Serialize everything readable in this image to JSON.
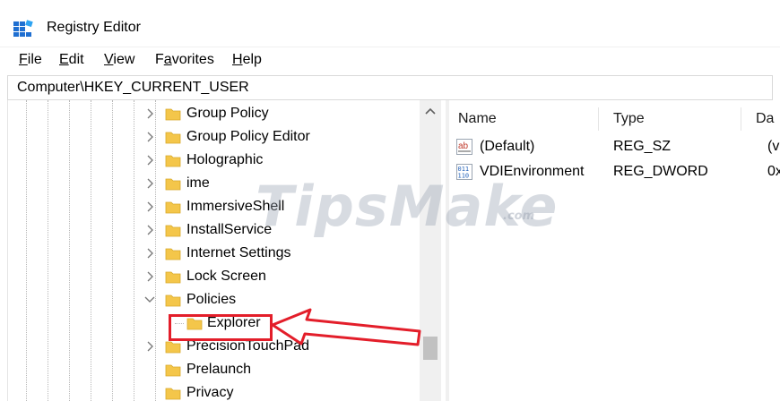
{
  "window": {
    "title": "Registry Editor"
  },
  "menu": [
    {
      "label": "File",
      "key": "F",
      "rest": "ile"
    },
    {
      "label": "Edit",
      "key": "E",
      "rest": "dit"
    },
    {
      "label": "View",
      "key": "V",
      "rest": "iew"
    },
    {
      "label": "Favorites",
      "key": "a",
      "pre": "F",
      "rest": "vorites"
    },
    {
      "label": "Help",
      "key": "H",
      "rest": "elp"
    }
  ],
  "address": {
    "path": "Computer\\HKEY_CURRENT_USER"
  },
  "tree": {
    "items": [
      {
        "label": "Group Policy",
        "expander": "collapsed"
      },
      {
        "label": "Group Policy Editor",
        "expander": "collapsed"
      },
      {
        "label": "Holographic",
        "expander": "collapsed"
      },
      {
        "label": "ime",
        "expander": "collapsed"
      },
      {
        "label": "ImmersiveShell",
        "expander": "collapsed"
      },
      {
        "label": "InstallService",
        "expander": "collapsed"
      },
      {
        "label": "Internet Settings",
        "expander": "collapsed"
      },
      {
        "label": "Lock Screen",
        "expander": "collapsed"
      },
      {
        "label": "Policies",
        "expander": "expanded"
      },
      {
        "label": "Explorer",
        "expander": "none",
        "selected": true
      },
      {
        "label": "PrecisionTouchPad",
        "expander": "collapsed"
      },
      {
        "label": "Prelaunch",
        "expander": "none"
      },
      {
        "label": "Privacy",
        "expander": "none"
      }
    ]
  },
  "values": {
    "columns": [
      "Name",
      "Type",
      "Da"
    ],
    "rows": [
      {
        "icon": "string-value-icon",
        "name": "(Default)",
        "type": "REG_SZ",
        "data": "(v"
      },
      {
        "icon": "binary-value-icon",
        "name": "VDIEnvironment",
        "type": "REG_DWORD",
        "data": "0x"
      }
    ]
  },
  "watermark": {
    "main": "TipsMake",
    "suffix": ".com"
  },
  "colors": {
    "highlight": "#e31e2a",
    "folder": "#f4c64a",
    "watermark": "#96a0af"
  }
}
